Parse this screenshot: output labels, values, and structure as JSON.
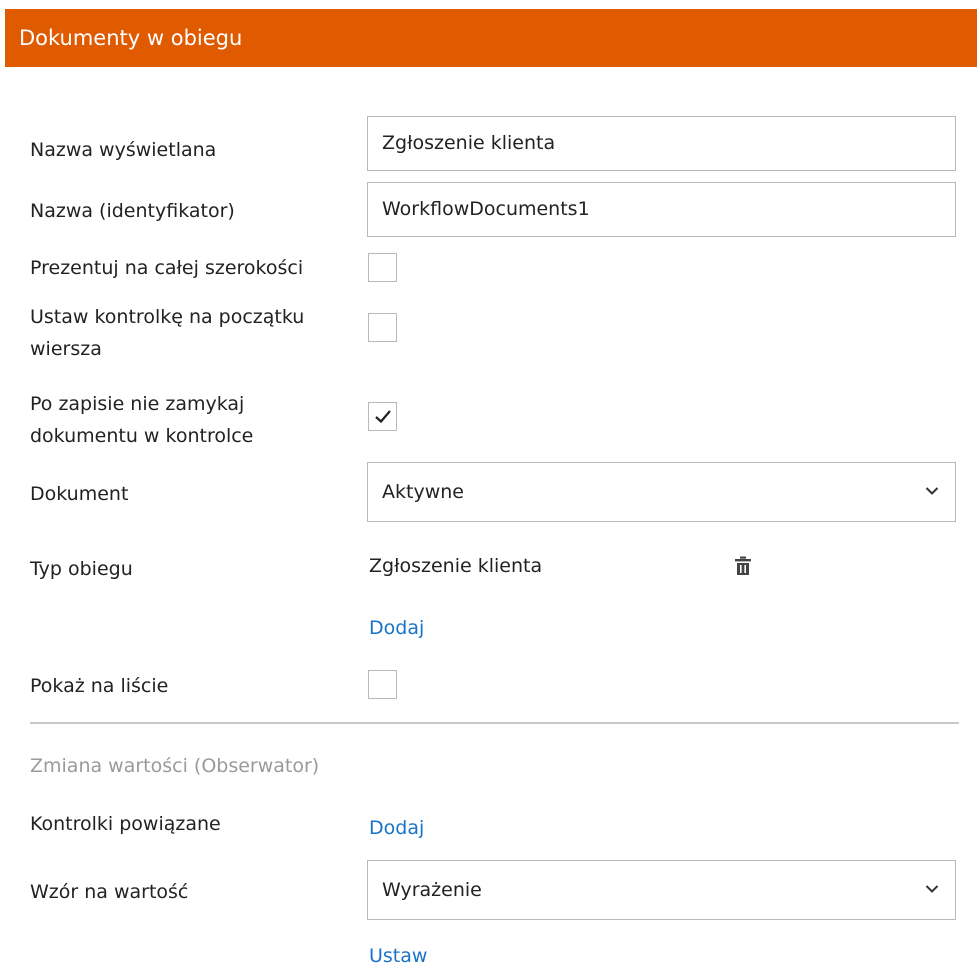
{
  "header": {
    "title": "Dokumenty w obiegu"
  },
  "fields": {
    "display_name": {
      "label": "Nazwa wyświetlana",
      "value": "Zgłoszenie klienta"
    },
    "identifier": {
      "label": "Nazwa (identyfikator)",
      "value": "WorkflowDocuments1"
    },
    "full_width": {
      "label": "Prezentuj na całej szerokości",
      "checked": false
    },
    "row_start": {
      "label_line1": "Ustaw kontrolkę na początku",
      "label_line2": "wiersza",
      "checked": false
    },
    "keep_open": {
      "label_line1": "Po zapisie nie zamykaj",
      "label_line2": "dokumentu w kontrolce",
      "checked": true
    },
    "document": {
      "label": "Dokument",
      "selected": "Aktywne"
    },
    "workflow_type": {
      "label": "Typ obiegu",
      "value": "Zgłoszenie klienta",
      "icon": "trash-icon",
      "add_label": "Dodaj"
    },
    "show_on_list": {
      "label": "Pokaż na liście",
      "checked": false
    }
  },
  "observer": {
    "section_title": "Zmiana wartości (Obserwator)",
    "related_controls": {
      "label": "Kontrolki powiązane",
      "add_label": "Dodaj"
    },
    "value_formula": {
      "label": "Wzór na wartość",
      "selected": "Wyrażenie",
      "set_label": "Ustaw"
    }
  },
  "colors": {
    "header_bg": "#e05a00",
    "link": "#1a73c8",
    "muted": "#9a9a9a",
    "border": "#b9b9b9"
  }
}
